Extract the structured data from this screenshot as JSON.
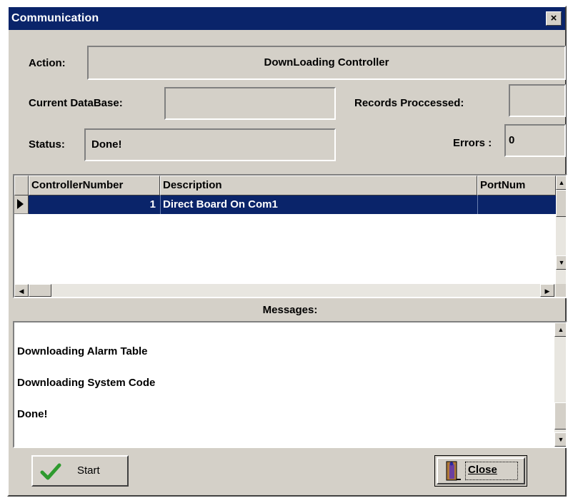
{
  "window": {
    "title": "Communication",
    "close_glyph": "×"
  },
  "action": {
    "label": "Action:",
    "value": "DownLoading Controller"
  },
  "current_database": {
    "label": "Current DataBase:",
    "value": ""
  },
  "records_processed": {
    "label": "Records Proccessed:",
    "value": ""
  },
  "status": {
    "label": "Status:",
    "value": "Done!"
  },
  "errors": {
    "label": "Errors :",
    "value": "0"
  },
  "grid": {
    "columns": [
      "ControllerNumber",
      "Description",
      "PortNum"
    ],
    "rows": [
      {
        "controller_number": "1",
        "description": "Direct Board On Com1",
        "port_num": "",
        "selected": true
      }
    ],
    "row_indicator_icon": "current-row-arrow-icon"
  },
  "messages": {
    "header": "Messages:",
    "lines": [
      "Downloading Alarm Table",
      "Downloading System Code",
      "Done!"
    ]
  },
  "buttons": {
    "start": {
      "label": "Start",
      "icon": "checkmark-icon"
    },
    "close": {
      "label": "Close",
      "icon": "door-exit-icon"
    }
  },
  "colors": {
    "titlebar": "#0a246a",
    "selection": "#0a246a",
    "face": "#d4d0c8",
    "check": "#2e9a2e"
  }
}
